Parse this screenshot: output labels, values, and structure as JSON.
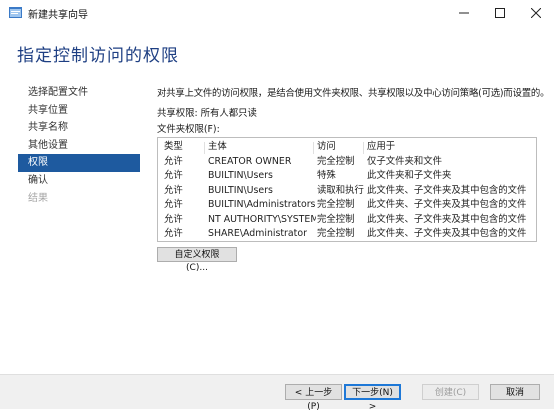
{
  "window": {
    "title": "新建共享向导"
  },
  "page_title": "指定控制访问的权限",
  "nav": [
    {
      "label": "选择配置文件",
      "state": "normal"
    },
    {
      "label": "共享位置",
      "state": "normal"
    },
    {
      "label": "共享名称",
      "state": "normal"
    },
    {
      "label": "其他设置",
      "state": "normal"
    },
    {
      "label": "权限",
      "state": "active"
    },
    {
      "label": "确认",
      "state": "normal"
    },
    {
      "label": "结果",
      "state": "disabled"
    }
  ],
  "main": {
    "description": "对共享上文件的访问权限，是结合使用文件夹权限、共享权限以及中心访问策略(可选)而设置的。",
    "share_permissions": "共享权限: 所有人都只读",
    "folder_permissions_label": "文件夹权限(F):"
  },
  "table": {
    "headers": [
      "类型",
      "主体",
      "访问",
      "应用于"
    ],
    "rows": [
      [
        "允许",
        "CREATOR OWNER",
        "完全控制",
        "仅子文件夹和文件"
      ],
      [
        "允许",
        "BUILTIN\\Users",
        "特殊",
        "此文件夹和子文件夹"
      ],
      [
        "允许",
        "BUILTIN\\Users",
        "读取和执行",
        "此文件夹、子文件夹及其中包含的文件"
      ],
      [
        "允许",
        "BUILTIN\\Administrators",
        "完全控制",
        "此文件夹、子文件夹及其中包含的文件"
      ],
      [
        "允许",
        "NT AUTHORITY\\SYSTEM",
        "完全控制",
        "此文件夹、子文件夹及其中包含的文件"
      ],
      [
        "允许",
        "SHARE\\Administrator",
        "完全控制",
        "此文件夹、子文件夹及其中包含的文件"
      ]
    ]
  },
  "buttons": {
    "custom_permissions": "自定义权限(C)...",
    "back": "< 上一步(P)",
    "next": "下一步(N) >",
    "create": "创建(C)",
    "cancel": "取消"
  },
  "colors": {
    "title_blue": "#1e3f83",
    "nav_active_bg": "#1e5a9f",
    "default_button_border": "#1e78d7"
  }
}
